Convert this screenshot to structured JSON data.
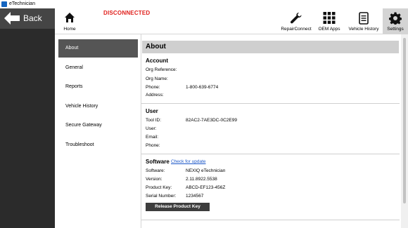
{
  "window": {
    "title": "eTechnician"
  },
  "back": {
    "label": "Back"
  },
  "status": {
    "text": "DISCONNECTED"
  },
  "toolbar": {
    "home": "Home",
    "repairconnect": "RepairConnect",
    "oem_apps": "OEM Apps",
    "vehicle_history": "Vehicle History",
    "settings": "Settings"
  },
  "menu": {
    "items": [
      {
        "label": "About"
      },
      {
        "label": "General"
      },
      {
        "label": "Reports"
      },
      {
        "label": "Vehicle History"
      },
      {
        "label": "Secure Gateway"
      },
      {
        "label": "Troubleshoot"
      }
    ]
  },
  "about": {
    "header": "About",
    "account": {
      "title": "Account",
      "org_reference_label": "Org Reference:",
      "org_name_label": "Org Name:",
      "phone_label": "Phone:",
      "phone_value": "1-800-639-6774",
      "address_label": "Address:"
    },
    "user": {
      "title": "User",
      "tool_id_label": "Tool ID:",
      "tool_id_value": "82AC2-7AE3DC-0C2E99",
      "user_label": "User:",
      "email_label": "Email:",
      "phone_label": "Phone:"
    },
    "software": {
      "title": "Software",
      "check_update": "Check for update",
      "software_label": "Software:",
      "software_value": "NEXIQ eTechnician",
      "version_label": "Version:",
      "version_value": "2.11.8922.5538",
      "product_key_label": "Product Key:",
      "product_key_value": "ABCD-EF123-456Z",
      "serial_label": "Serial Number:",
      "serial_value": "1234567",
      "release_button": "Release Product Key"
    }
  },
  "colors": {
    "accent_red": "#e0201c",
    "link_blue": "#1a56c8",
    "rail_dark": "#2b2b2b"
  }
}
